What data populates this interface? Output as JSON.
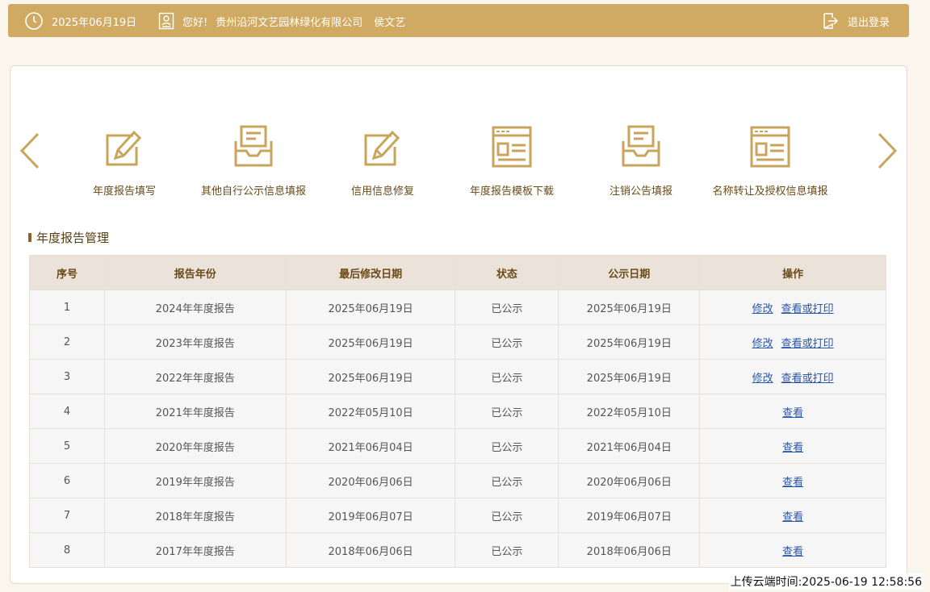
{
  "header": {
    "date": "2025年06月19日",
    "greeting": "您好!",
    "company": "贵州沿河文艺园林绿化有限公司",
    "user": "侯文艺",
    "logout_label": "退出登录"
  },
  "nav": {
    "items": [
      {
        "label": "年度报告填写",
        "icon": "edit-icon"
      },
      {
        "label": "其他自行公示信息填报",
        "icon": "inbox-icon"
      },
      {
        "label": "信用信息修复",
        "icon": "edit-icon"
      },
      {
        "label": "年度报告模板下载",
        "icon": "template-icon"
      },
      {
        "label": "注销公告填报",
        "icon": "inbox-icon"
      },
      {
        "label": "名称转让及授权信息填报",
        "icon": "template-icon"
      }
    ]
  },
  "section": {
    "title": "年度报告管理"
  },
  "table": {
    "headers": [
      "序号",
      "报告年份",
      "最后修改日期",
      "状态",
      "公示日期",
      "操作"
    ],
    "rows": [
      {
        "no": "1",
        "year": "2024年年度报告",
        "modified": "2025年06月19日",
        "status": "已公示",
        "published": "2025年06月19日",
        "actions": [
          "修改",
          "查看或打印"
        ]
      },
      {
        "no": "2",
        "year": "2023年年度报告",
        "modified": "2025年06月19日",
        "status": "已公示",
        "published": "2025年06月19日",
        "actions": [
          "修改",
          "查看或打印"
        ]
      },
      {
        "no": "3",
        "year": "2022年年度报告",
        "modified": "2025年06月19日",
        "status": "已公示",
        "published": "2025年06月19日",
        "actions": [
          "修改",
          "查看或打印"
        ]
      },
      {
        "no": "4",
        "year": "2021年年度报告",
        "modified": "2022年05月10日",
        "status": "已公示",
        "published": "2022年05月10日",
        "actions": [
          "查看"
        ]
      },
      {
        "no": "5",
        "year": "2020年年度报告",
        "modified": "2021年06月04日",
        "status": "已公示",
        "published": "2021年06月04日",
        "actions": [
          "查看"
        ]
      },
      {
        "no": "6",
        "year": "2019年年度报告",
        "modified": "2020年06月06日",
        "status": "已公示",
        "published": "2020年06月06日",
        "actions": [
          "查看"
        ]
      },
      {
        "no": "7",
        "year": "2018年年度报告",
        "modified": "2019年06月07日",
        "status": "已公示",
        "published": "2019年06月07日",
        "actions": [
          "查看"
        ]
      },
      {
        "no": "8",
        "year": "2017年年度报告",
        "modified": "2018年06月06日",
        "status": "已公示",
        "published": "2018年06月06日",
        "actions": [
          "查看"
        ]
      }
    ]
  },
  "footer": {
    "upload_time": "上传云端时间:2025-06-19 12:58:56"
  },
  "colors": {
    "accent": "#d0aa62",
    "icon": "#c9a55c",
    "link": "#2a56a8"
  }
}
